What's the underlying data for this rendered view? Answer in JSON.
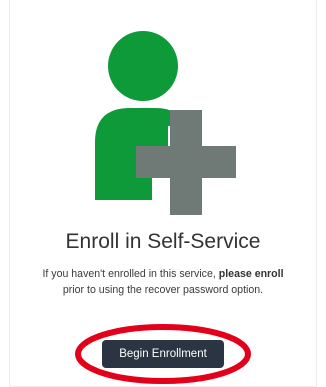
{
  "card": {
    "icon": "enroll-user-plus-icon",
    "title": "Enroll in Self-Service",
    "description_line1_a": "If you haven't enrolled in this service, ",
    "description_line1_b": "please enroll",
    "description_line2": "prior to using the recover password option.",
    "button_label": "Begin Enrollment"
  },
  "colors": {
    "user_icon": "#0f9a3a",
    "plus_icon": "#6f7a76",
    "button_bg": "#2b3442",
    "highlight_ring": "#e3001b"
  }
}
